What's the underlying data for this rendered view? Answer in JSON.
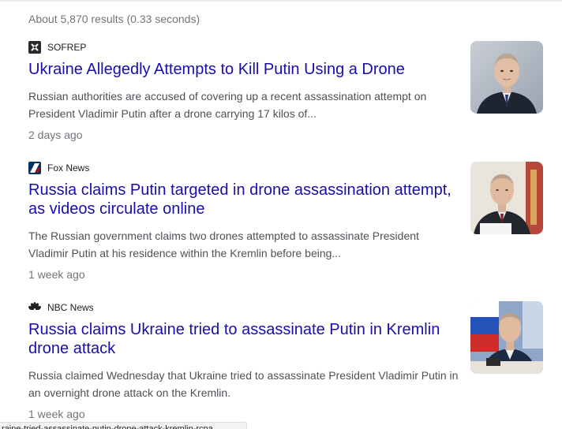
{
  "results_stats": "About 5,870 results (0.33 seconds)",
  "results": [
    {
      "source": "SOFREP",
      "title": "Ukraine Allegedly Attempts to Kill Putin Using a Drone",
      "snippet": "Russian authorities are accused of covering up a recent assassination attempt on President Vladimir Putin after a drone carrying 17 kilos of...",
      "age": "2 days ago",
      "source_icon": "sofrep-logo-icon",
      "thumbnail": "putin-portrait-thumbnail"
    },
    {
      "source": "Fox News",
      "title": "Russia claims Putin targeted in drone assassination attempt, as videos circulate online",
      "snippet": "The Russian government claims two drones attempted to assassinate President Vladimir Putin at his residence within the Kremlin before being...",
      "age": "1 week ago",
      "source_icon": "fox-news-logo-icon",
      "thumbnail": "putin-meeting-thumbnail"
    },
    {
      "source": "NBC News",
      "title": "Russia claims Ukraine tried to assassinate Putin in Kremlin drone attack",
      "snippet": "Russia claimed Wednesday that Ukraine tried to assassinate President Vladimir Putin in an overnight drone attack on the Kremlin.",
      "age": "1 week ago",
      "source_icon": "nbc-peacock-logo-icon",
      "thumbnail": "putin-desk-flag-thumbnail"
    }
  ],
  "status_url": "raine-tried-assassinate-putin-drone-attack-kremlin-rcna",
  "colors": {
    "link": "#1a0dab",
    "snippet": "#4d5156",
    "meta": "#70757a"
  }
}
